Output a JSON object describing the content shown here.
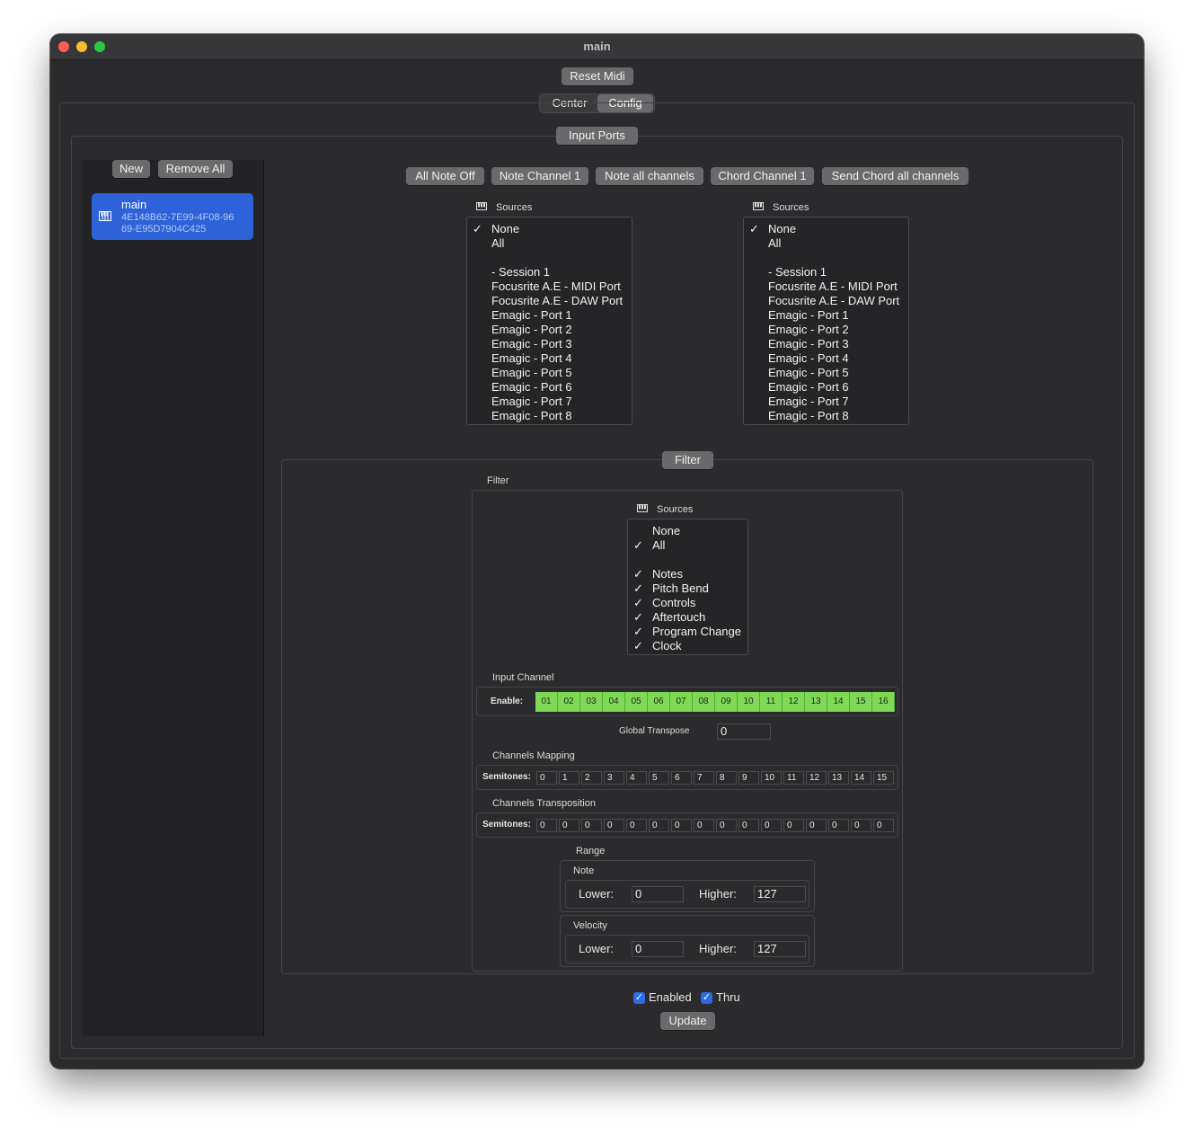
{
  "window": {
    "title": "main"
  },
  "toolbar": {
    "reset_midi": "Reset Midi"
  },
  "tabs": [
    {
      "label": "Center"
    },
    {
      "label": "Config"
    }
  ],
  "input_ports": {
    "title": "Input Ports"
  },
  "sidebar": {
    "new_label": "New",
    "remove_all_label": "Remove All",
    "items": [
      {
        "name": "main",
        "id_line1": "4E148B62-7E99-4F08-96",
        "id_line2": "69-E95D7904C425",
        "icon": "midi-keyboard-icon"
      }
    ]
  },
  "actions": [
    "All Note Off",
    "Note Channel 1",
    "Note all channels",
    "Chord Channel 1",
    "Send Chord all channels"
  ],
  "sources_left": {
    "label": "Sources",
    "items": [
      {
        "text": "None",
        "checked": true
      },
      {
        "text": "All",
        "checked": false
      },
      {
        "text": "",
        "checked": false
      },
      {
        "text": "- Session 1",
        "checked": false
      },
      {
        "text": "Focusrite A.E - MIDI Port",
        "checked": false
      },
      {
        "text": "Focusrite A.E - DAW Port",
        "checked": false
      },
      {
        "text": "Emagic - Port 1",
        "checked": false
      },
      {
        "text": "Emagic - Port 2",
        "checked": false
      },
      {
        "text": "Emagic - Port 3",
        "checked": false
      },
      {
        "text": "Emagic - Port 4",
        "checked": false
      },
      {
        "text": "Emagic - Port 5",
        "checked": false
      },
      {
        "text": "Emagic - Port 6",
        "checked": false
      },
      {
        "text": "Emagic - Port 7",
        "checked": false
      },
      {
        "text": "Emagic - Port 8",
        "checked": false
      }
    ]
  },
  "sources_right": {
    "label": "Sources",
    "items": [
      {
        "text": "None",
        "checked": true
      },
      {
        "text": "All",
        "checked": false
      },
      {
        "text": "",
        "checked": false
      },
      {
        "text": "- Session 1",
        "checked": false
      },
      {
        "text": "Focusrite A.E - MIDI Port",
        "checked": false
      },
      {
        "text": "Focusrite A.E - DAW Port",
        "checked": false
      },
      {
        "text": "Emagic - Port 1",
        "checked": false
      },
      {
        "text": "Emagic - Port 2",
        "checked": false
      },
      {
        "text": "Emagic - Port 3",
        "checked": false
      },
      {
        "text": "Emagic - Port 4",
        "checked": false
      },
      {
        "text": "Emagic - Port 5",
        "checked": false
      },
      {
        "text": "Emagic - Port 6",
        "checked": false
      },
      {
        "text": "Emagic - Port 7",
        "checked": false
      },
      {
        "text": "Emagic - Port 8",
        "checked": false
      }
    ]
  },
  "filter": {
    "tab_label": "Filter",
    "group_label": "Filter",
    "sources": {
      "label": "Sources",
      "items": [
        {
          "text": "None",
          "checked": false
        },
        {
          "text": "All",
          "checked": true
        },
        {
          "text": "",
          "checked": false
        },
        {
          "text": "Notes",
          "checked": true
        },
        {
          "text": "Pitch Bend",
          "checked": true
        },
        {
          "text": "Controls",
          "checked": true
        },
        {
          "text": "Aftertouch",
          "checked": true
        },
        {
          "text": "Program Change",
          "checked": true
        },
        {
          "text": "Clock",
          "checked": true
        }
      ]
    },
    "input_channel": {
      "label": "Input Channel",
      "enable_label": "Enable:",
      "channels": [
        "01",
        "02",
        "03",
        "04",
        "05",
        "06",
        "07",
        "08",
        "09",
        "10",
        "11",
        "12",
        "13",
        "14",
        "15",
        "16"
      ],
      "enabled_color": "#7ed957"
    },
    "global_transpose": {
      "label": "Global Transpose",
      "value": "0"
    },
    "channels_mapping": {
      "label": "Channels Mapping",
      "row_label": "Semitones:",
      "values": [
        "0",
        "1",
        "2",
        "3",
        "4",
        "5",
        "6",
        "7",
        "8",
        "9",
        "10",
        "11",
        "12",
        "13",
        "14",
        "15"
      ]
    },
    "channels_transposition": {
      "label": "Channels Transposition",
      "row_label": "Semitones:",
      "values": [
        "0",
        "0",
        "0",
        "0",
        "0",
        "0",
        "0",
        "0",
        "0",
        "0",
        "0",
        "0",
        "0",
        "0",
        "0",
        "0"
      ]
    },
    "range": {
      "label": "Range",
      "note": {
        "label": "Note",
        "lower_label": "Lower:",
        "lower": "0",
        "higher_label": "Higher:",
        "higher": "127"
      },
      "velocity": {
        "label": "Velocity",
        "lower_label": "Lower:",
        "lower": "0",
        "higher_label": "Higher:",
        "higher": "127"
      }
    }
  },
  "footer": {
    "enabled_label": "Enabled",
    "enabled": true,
    "thru_label": "Thru",
    "thru": true,
    "update_label": "Update"
  },
  "colors": {
    "accent": "#2d62d8",
    "checkbox": "#2d6ae3"
  }
}
